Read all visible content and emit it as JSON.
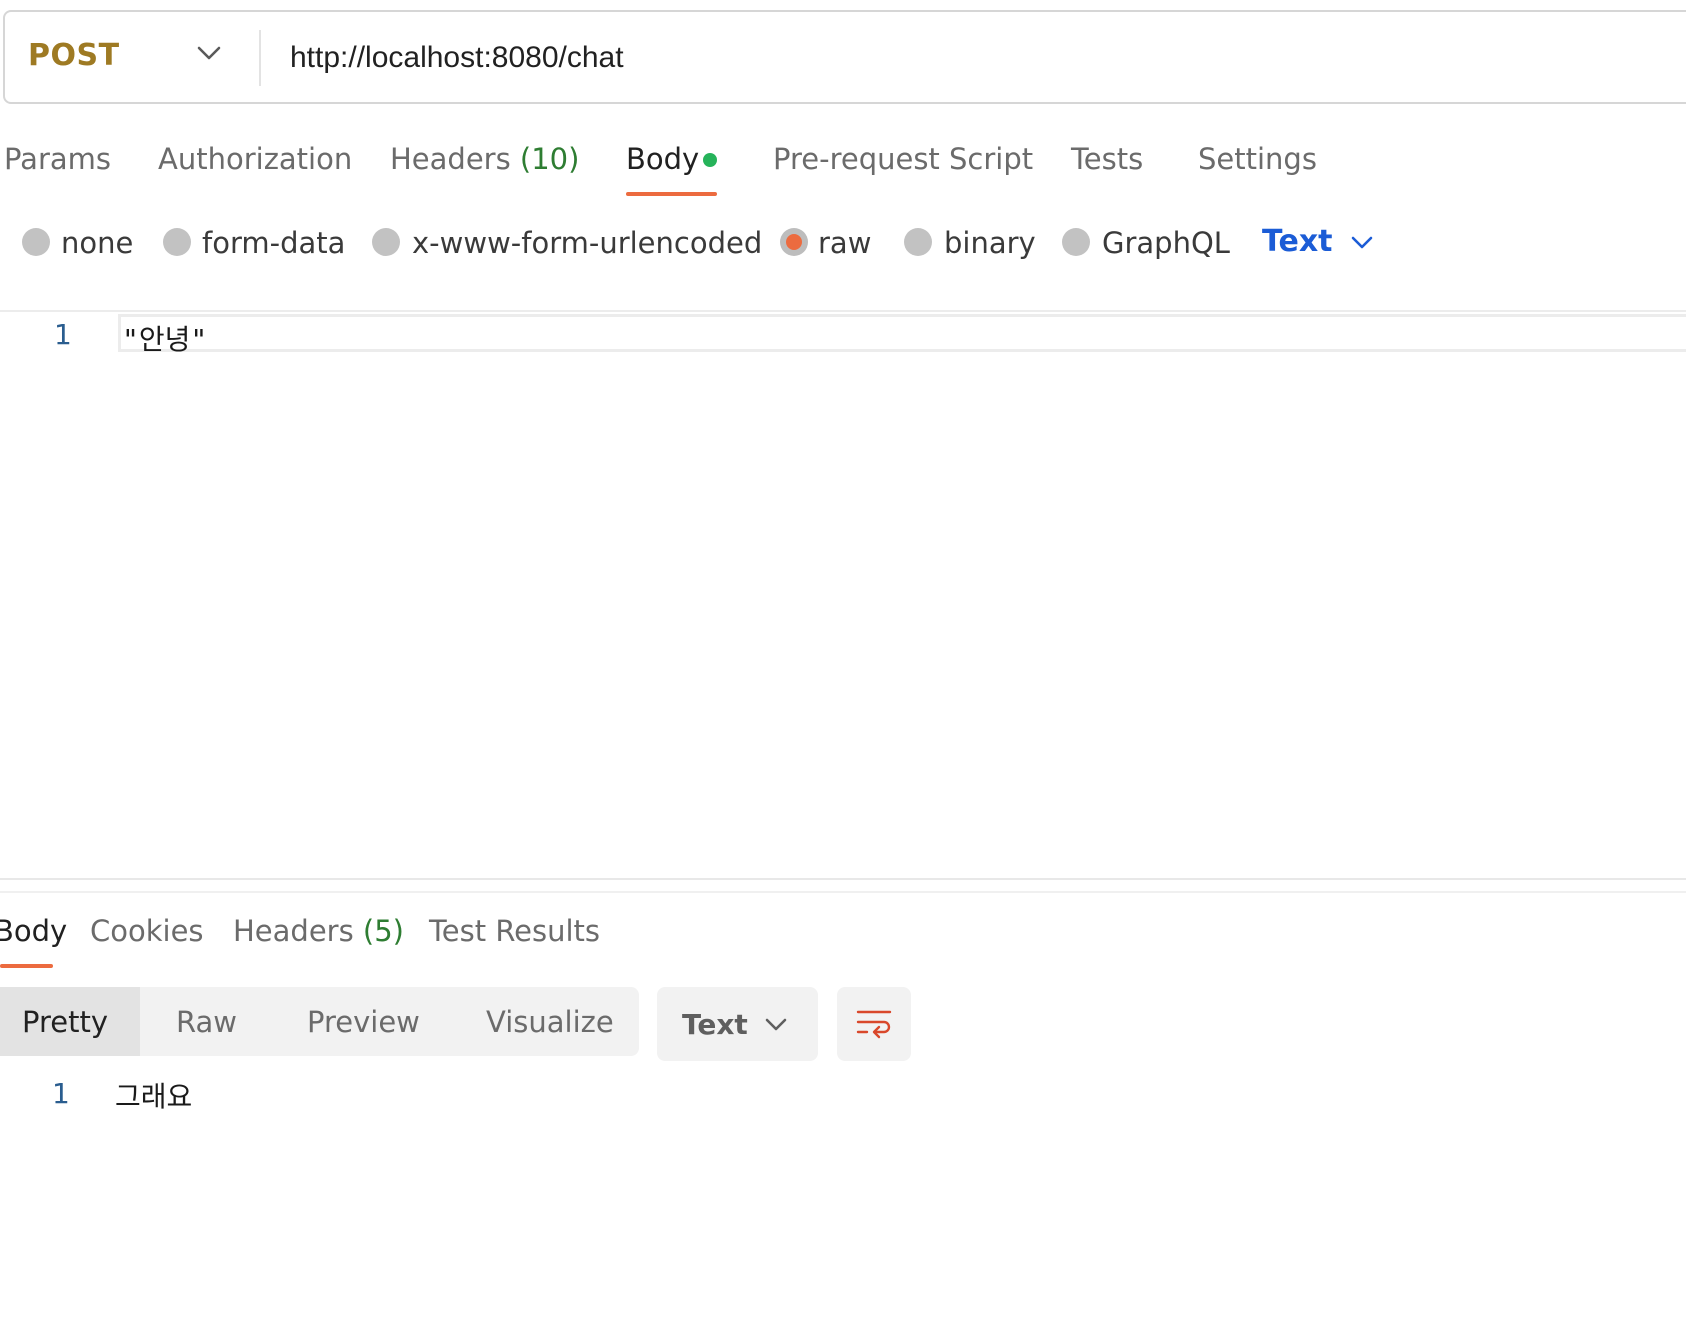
{
  "request": {
    "method": "POST",
    "url": "http://localhost:8080/chat"
  },
  "request_tabs": {
    "params": "Params",
    "authorization": "Authorization",
    "headers": "Headers",
    "headers_count": "(10)",
    "body": "Body",
    "pre_request": "Pre-request Script",
    "tests": "Tests",
    "settings": "Settings"
  },
  "body_types": {
    "none": "none",
    "form_data": "form-data",
    "urlencoded": "x-www-form-urlencoded",
    "raw": "raw",
    "binary": "binary",
    "graphql": "GraphQL",
    "selected": "raw",
    "language": "Text"
  },
  "request_body": {
    "line_number": "1",
    "line_text": "\"안녕\""
  },
  "response_tabs": {
    "body": "Body",
    "cookies": "Cookies",
    "headers": "Headers",
    "headers_count": "(5)",
    "test_results": "Test Results"
  },
  "response_view": {
    "pretty": "Pretty",
    "raw": "Raw",
    "preview": "Preview",
    "visualize": "Visualize",
    "format": "Text"
  },
  "response_body": {
    "line_number": "1",
    "line_text": "그래요"
  },
  "colors": {
    "accent": "#ec6b3f",
    "method": "#9e7a23",
    "link_blue": "#1b5cd6",
    "count_green": "#2e7d32",
    "dot_green": "#26b35a"
  },
  "icons": {
    "method_dropdown": "chevron-down-icon",
    "language_dropdown": "chevron-down-icon",
    "format_dropdown": "chevron-down-icon",
    "wrap": "wrap-lines-icon"
  }
}
